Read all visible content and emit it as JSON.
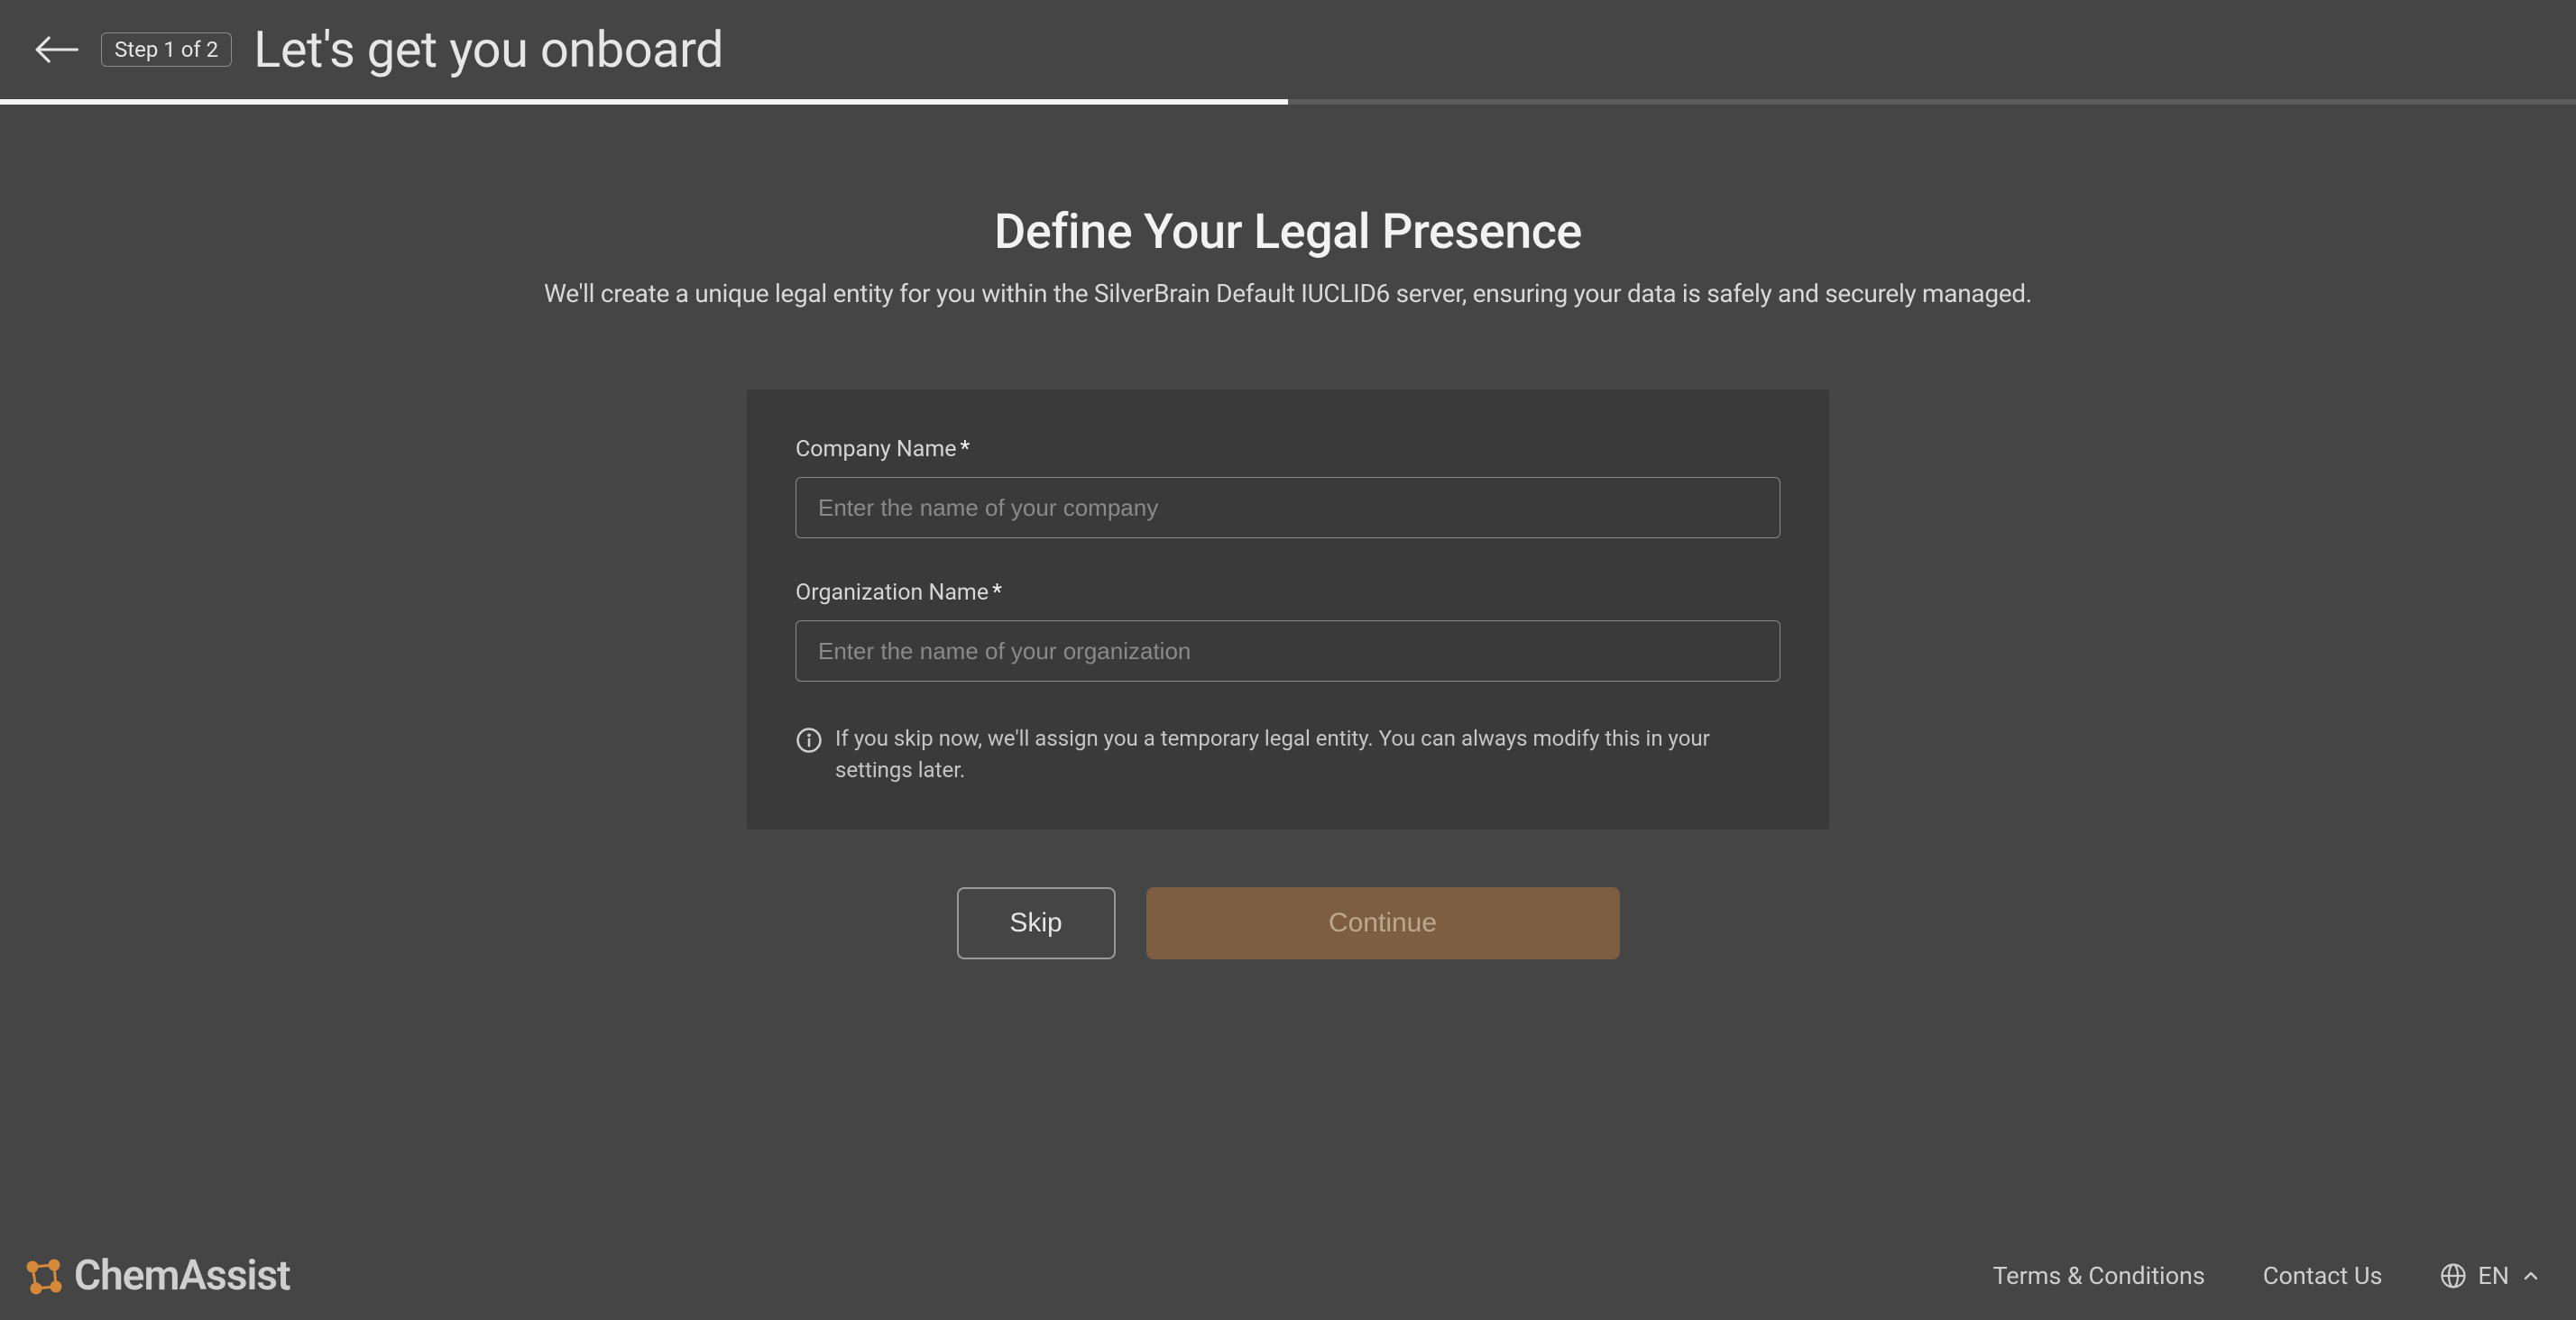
{
  "header": {
    "step_badge": "Step 1 of 2",
    "title": "Let's get you onboard"
  },
  "progress": {
    "percent": 50
  },
  "main": {
    "heading": "Define Your Legal Presence",
    "subtitle": "We'll create a unique legal entity for you within the SilverBrain Default IUCLID6 server, ensuring your data is safely and securely managed.",
    "form": {
      "company_name": {
        "label": "Company Name",
        "required": "*",
        "placeholder": "Enter the name of your company",
        "value": ""
      },
      "organization_name": {
        "label": "Organization Name",
        "required": "*",
        "placeholder": "Enter the name of your organization",
        "value": ""
      },
      "hint": "If you skip now, we'll assign you a temporary legal entity. You can always modify this in your settings later."
    },
    "actions": {
      "skip_label": "Skip",
      "continue_label": "Continue"
    }
  },
  "footer": {
    "brand": "ChemAssist",
    "terms_label": "Terms & Conditions",
    "contact_label": "Contact Us",
    "language": "EN"
  },
  "colors": {
    "bg": "#454545",
    "card": "#3a3a3a",
    "accent_btn": "#7d5e40",
    "accent_btn_text": "#bca88f",
    "brand_icon": "#d48a3a"
  }
}
